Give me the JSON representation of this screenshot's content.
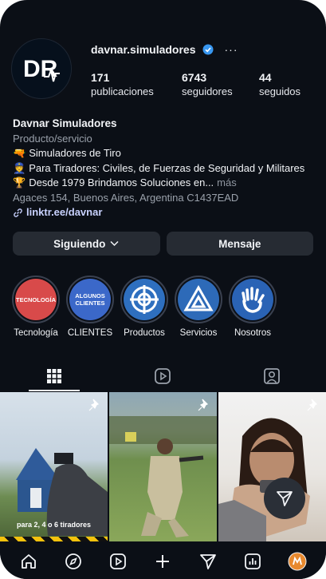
{
  "profile": {
    "username": "davnar.simuladores",
    "more_glyph": "···",
    "avatar_text": "DR",
    "stats": [
      {
        "value": "171",
        "label": "publicaciones"
      },
      {
        "value": "6743",
        "label": "seguidores"
      },
      {
        "value": "44",
        "label": "seguidos"
      }
    ]
  },
  "bio": {
    "name": "Davnar Simuladores",
    "category": "Producto/servicio",
    "lines": [
      {
        "emoji": "🔫",
        "text": "Simuladores de Tiro"
      },
      {
        "emoji": "👮",
        "text": "Para Tiradores: Civiles, de Fuerzas de Seguridad y Militares"
      },
      {
        "emoji": "🏆",
        "text": "Desde 1979 Brindamos Soluciones en...",
        "more": " más"
      }
    ],
    "address": "Agaces 154, Buenos Aires, Argentina C1437EAD",
    "link": "linktr.ee/davnar"
  },
  "buttons": {
    "following": "Siguiendo",
    "message": "Mensaje"
  },
  "highlights": [
    {
      "label": "Tecnología",
      "inner_text": "TECNOLOGÍA",
      "color": "#d84a4a"
    },
    {
      "label": "CLIENTES",
      "inner_text": "ALGUNOS CLIENTES",
      "color": "#3b68c9"
    },
    {
      "label": "Productos",
      "inner_text": "",
      "color": "#2e6fbf"
    },
    {
      "label": "Servicios",
      "inner_text": "",
      "color": "#2d6ab8"
    },
    {
      "label": "Nosotros",
      "inner_text": "",
      "color": "#2a63b5"
    }
  ],
  "posts": [
    {
      "caption": "para 2, 4 o 6 tiradores"
    },
    {
      "caption": ""
    },
    {
      "caption": ""
    }
  ],
  "colors": {
    "background": "#0b0f16",
    "button": "#262b33",
    "verified": "#3897f0",
    "link": "#c9d2ff"
  }
}
